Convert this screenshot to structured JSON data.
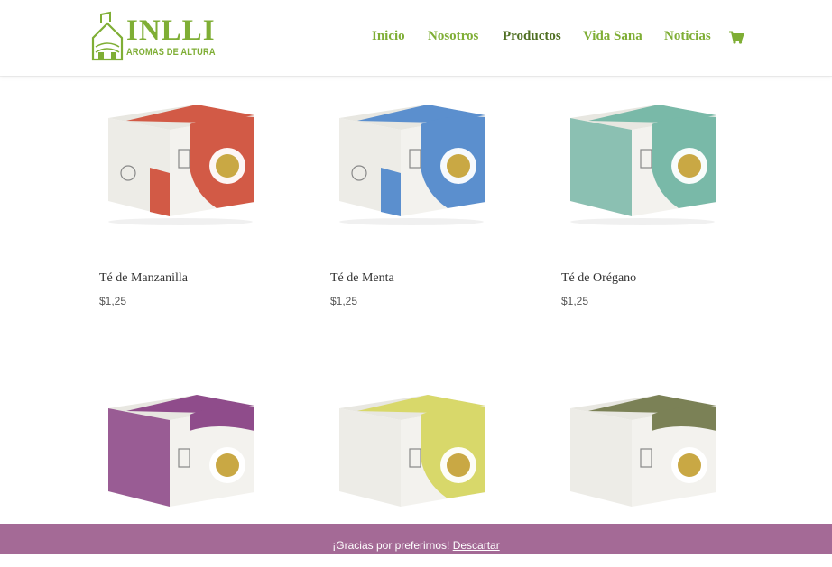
{
  "brand": {
    "name": "INLLI",
    "tagline": "AROMAS DE ALTURA",
    "color": "#7fae35"
  },
  "nav": {
    "items": [
      {
        "label": "Inicio"
      },
      {
        "label": "Nosotros"
      },
      {
        "label": "Productos"
      },
      {
        "label": "Vida Sana"
      },
      {
        "label": "Noticias"
      }
    ],
    "cart_icon": "cart-icon",
    "active_color": "#4f6f22"
  },
  "products": [
    {
      "name": "Té de Manzanilla",
      "price": "$1,25",
      "color": "#d25a46"
    },
    {
      "name": "Té de Menta",
      "price": "$1,25",
      "color": "#5b8fce"
    },
    {
      "name": "Té de Orégano",
      "price": "$1,25",
      "color": "#79b9a8"
    },
    {
      "name": "",
      "price": "",
      "color": "#8f4c8b"
    },
    {
      "name": "",
      "price": "",
      "color": "#d8d86a"
    },
    {
      "name": "",
      "price": "",
      "color": "#7b8156"
    }
  ],
  "notice": {
    "text": "¡Gracias por preferirnos!",
    "dismiss": "Descartar",
    "color": "#a46a96"
  }
}
